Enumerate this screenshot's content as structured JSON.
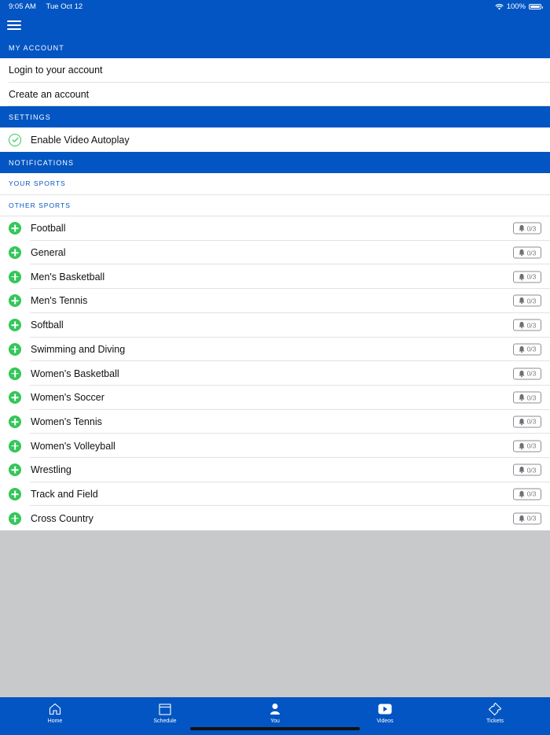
{
  "status_bar": {
    "time": "9:05 AM",
    "date": "Tue Oct 12",
    "battery": "100%"
  },
  "sections": {
    "my_account": {
      "header": "MY ACCOUNT",
      "items": [
        "Login to your account",
        "Create an account"
      ]
    },
    "settings": {
      "header": "SETTINGS",
      "autoplay_label": "Enable Video Autoplay"
    },
    "notifications": {
      "header": "NOTIFICATIONS",
      "your_sports_header": "YOUR SPORTS",
      "other_sports_header": "OTHER SPORTS"
    }
  },
  "sports": [
    {
      "name": "Football",
      "count": "0/3"
    },
    {
      "name": "General",
      "count": "0/3"
    },
    {
      "name": "Men's Basketball",
      "count": "0/3"
    },
    {
      "name": "Men's Tennis",
      "count": "0/3"
    },
    {
      "name": "Softball",
      "count": "0/3"
    },
    {
      "name": "Swimming and Diving",
      "count": "0/3"
    },
    {
      "name": "Women's Basketball",
      "count": "0/3"
    },
    {
      "name": "Women's Soccer",
      "count": "0/3"
    },
    {
      "name": "Women's Tennis",
      "count": "0/3"
    },
    {
      "name": "Women's Volleyball",
      "count": "0/3"
    },
    {
      "name": "Wrestling",
      "count": "0/3"
    },
    {
      "name": "Track and Field",
      "count": "0/3"
    },
    {
      "name": "Cross Country",
      "count": "0/3"
    }
  ],
  "tabs": {
    "home": "Home",
    "schedule": "Schedule",
    "you": "You",
    "videos": "Videos",
    "tickets": "Tickets"
  },
  "colors": {
    "brand_blue": "#0255c2",
    "add_green": "#34c759",
    "background_gray": "#c8c9cb"
  }
}
